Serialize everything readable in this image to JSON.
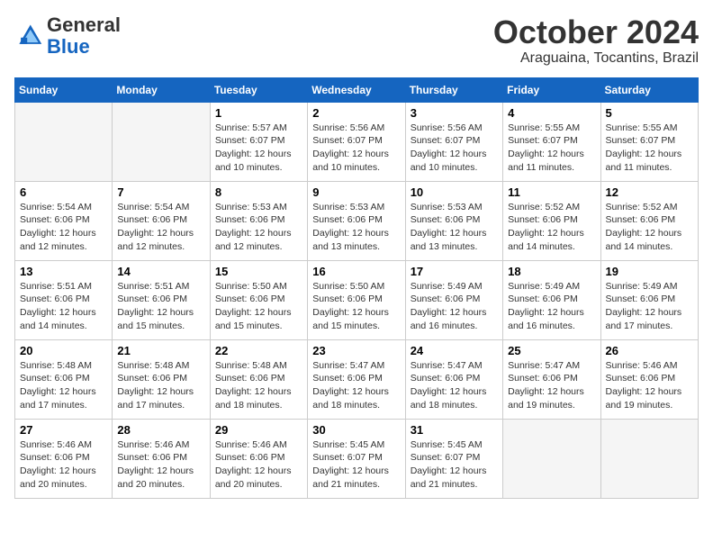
{
  "logo": {
    "general": "General",
    "blue": "Blue"
  },
  "header": {
    "month": "October 2024",
    "location": "Araguaina, Tocantins, Brazil"
  },
  "weekdays": [
    "Sunday",
    "Monday",
    "Tuesday",
    "Wednesday",
    "Thursday",
    "Friday",
    "Saturday"
  ],
  "weeks": [
    [
      {
        "day": "",
        "info": ""
      },
      {
        "day": "",
        "info": ""
      },
      {
        "day": "1",
        "info": "Sunrise: 5:57 AM\nSunset: 6:07 PM\nDaylight: 12 hours\nand 10 minutes."
      },
      {
        "day": "2",
        "info": "Sunrise: 5:56 AM\nSunset: 6:07 PM\nDaylight: 12 hours\nand 10 minutes."
      },
      {
        "day": "3",
        "info": "Sunrise: 5:56 AM\nSunset: 6:07 PM\nDaylight: 12 hours\nand 10 minutes."
      },
      {
        "day": "4",
        "info": "Sunrise: 5:55 AM\nSunset: 6:07 PM\nDaylight: 12 hours\nand 11 minutes."
      },
      {
        "day": "5",
        "info": "Sunrise: 5:55 AM\nSunset: 6:07 PM\nDaylight: 12 hours\nand 11 minutes."
      }
    ],
    [
      {
        "day": "6",
        "info": "Sunrise: 5:54 AM\nSunset: 6:06 PM\nDaylight: 12 hours\nand 12 minutes."
      },
      {
        "day": "7",
        "info": "Sunrise: 5:54 AM\nSunset: 6:06 PM\nDaylight: 12 hours\nand 12 minutes."
      },
      {
        "day": "8",
        "info": "Sunrise: 5:53 AM\nSunset: 6:06 PM\nDaylight: 12 hours\nand 12 minutes."
      },
      {
        "day": "9",
        "info": "Sunrise: 5:53 AM\nSunset: 6:06 PM\nDaylight: 12 hours\nand 13 minutes."
      },
      {
        "day": "10",
        "info": "Sunrise: 5:53 AM\nSunset: 6:06 PM\nDaylight: 12 hours\nand 13 minutes."
      },
      {
        "day": "11",
        "info": "Sunrise: 5:52 AM\nSunset: 6:06 PM\nDaylight: 12 hours\nand 14 minutes."
      },
      {
        "day": "12",
        "info": "Sunrise: 5:52 AM\nSunset: 6:06 PM\nDaylight: 12 hours\nand 14 minutes."
      }
    ],
    [
      {
        "day": "13",
        "info": "Sunrise: 5:51 AM\nSunset: 6:06 PM\nDaylight: 12 hours\nand 14 minutes."
      },
      {
        "day": "14",
        "info": "Sunrise: 5:51 AM\nSunset: 6:06 PM\nDaylight: 12 hours\nand 15 minutes."
      },
      {
        "day": "15",
        "info": "Sunrise: 5:50 AM\nSunset: 6:06 PM\nDaylight: 12 hours\nand 15 minutes."
      },
      {
        "day": "16",
        "info": "Sunrise: 5:50 AM\nSunset: 6:06 PM\nDaylight: 12 hours\nand 15 minutes."
      },
      {
        "day": "17",
        "info": "Sunrise: 5:49 AM\nSunset: 6:06 PM\nDaylight: 12 hours\nand 16 minutes."
      },
      {
        "day": "18",
        "info": "Sunrise: 5:49 AM\nSunset: 6:06 PM\nDaylight: 12 hours\nand 16 minutes."
      },
      {
        "day": "19",
        "info": "Sunrise: 5:49 AM\nSunset: 6:06 PM\nDaylight: 12 hours\nand 17 minutes."
      }
    ],
    [
      {
        "day": "20",
        "info": "Sunrise: 5:48 AM\nSunset: 6:06 PM\nDaylight: 12 hours\nand 17 minutes."
      },
      {
        "day": "21",
        "info": "Sunrise: 5:48 AM\nSunset: 6:06 PM\nDaylight: 12 hours\nand 17 minutes."
      },
      {
        "day": "22",
        "info": "Sunrise: 5:48 AM\nSunset: 6:06 PM\nDaylight: 12 hours\nand 18 minutes."
      },
      {
        "day": "23",
        "info": "Sunrise: 5:47 AM\nSunset: 6:06 PM\nDaylight: 12 hours\nand 18 minutes."
      },
      {
        "day": "24",
        "info": "Sunrise: 5:47 AM\nSunset: 6:06 PM\nDaylight: 12 hours\nand 18 minutes."
      },
      {
        "day": "25",
        "info": "Sunrise: 5:47 AM\nSunset: 6:06 PM\nDaylight: 12 hours\nand 19 minutes."
      },
      {
        "day": "26",
        "info": "Sunrise: 5:46 AM\nSunset: 6:06 PM\nDaylight: 12 hours\nand 19 minutes."
      }
    ],
    [
      {
        "day": "27",
        "info": "Sunrise: 5:46 AM\nSunset: 6:06 PM\nDaylight: 12 hours\nand 20 minutes."
      },
      {
        "day": "28",
        "info": "Sunrise: 5:46 AM\nSunset: 6:06 PM\nDaylight: 12 hours\nand 20 minutes."
      },
      {
        "day": "29",
        "info": "Sunrise: 5:46 AM\nSunset: 6:06 PM\nDaylight: 12 hours\nand 20 minutes."
      },
      {
        "day": "30",
        "info": "Sunrise: 5:45 AM\nSunset: 6:07 PM\nDaylight: 12 hours\nand 21 minutes."
      },
      {
        "day": "31",
        "info": "Sunrise: 5:45 AM\nSunset: 6:07 PM\nDaylight: 12 hours\nand 21 minutes."
      },
      {
        "day": "",
        "info": ""
      },
      {
        "day": "",
        "info": ""
      }
    ]
  ]
}
